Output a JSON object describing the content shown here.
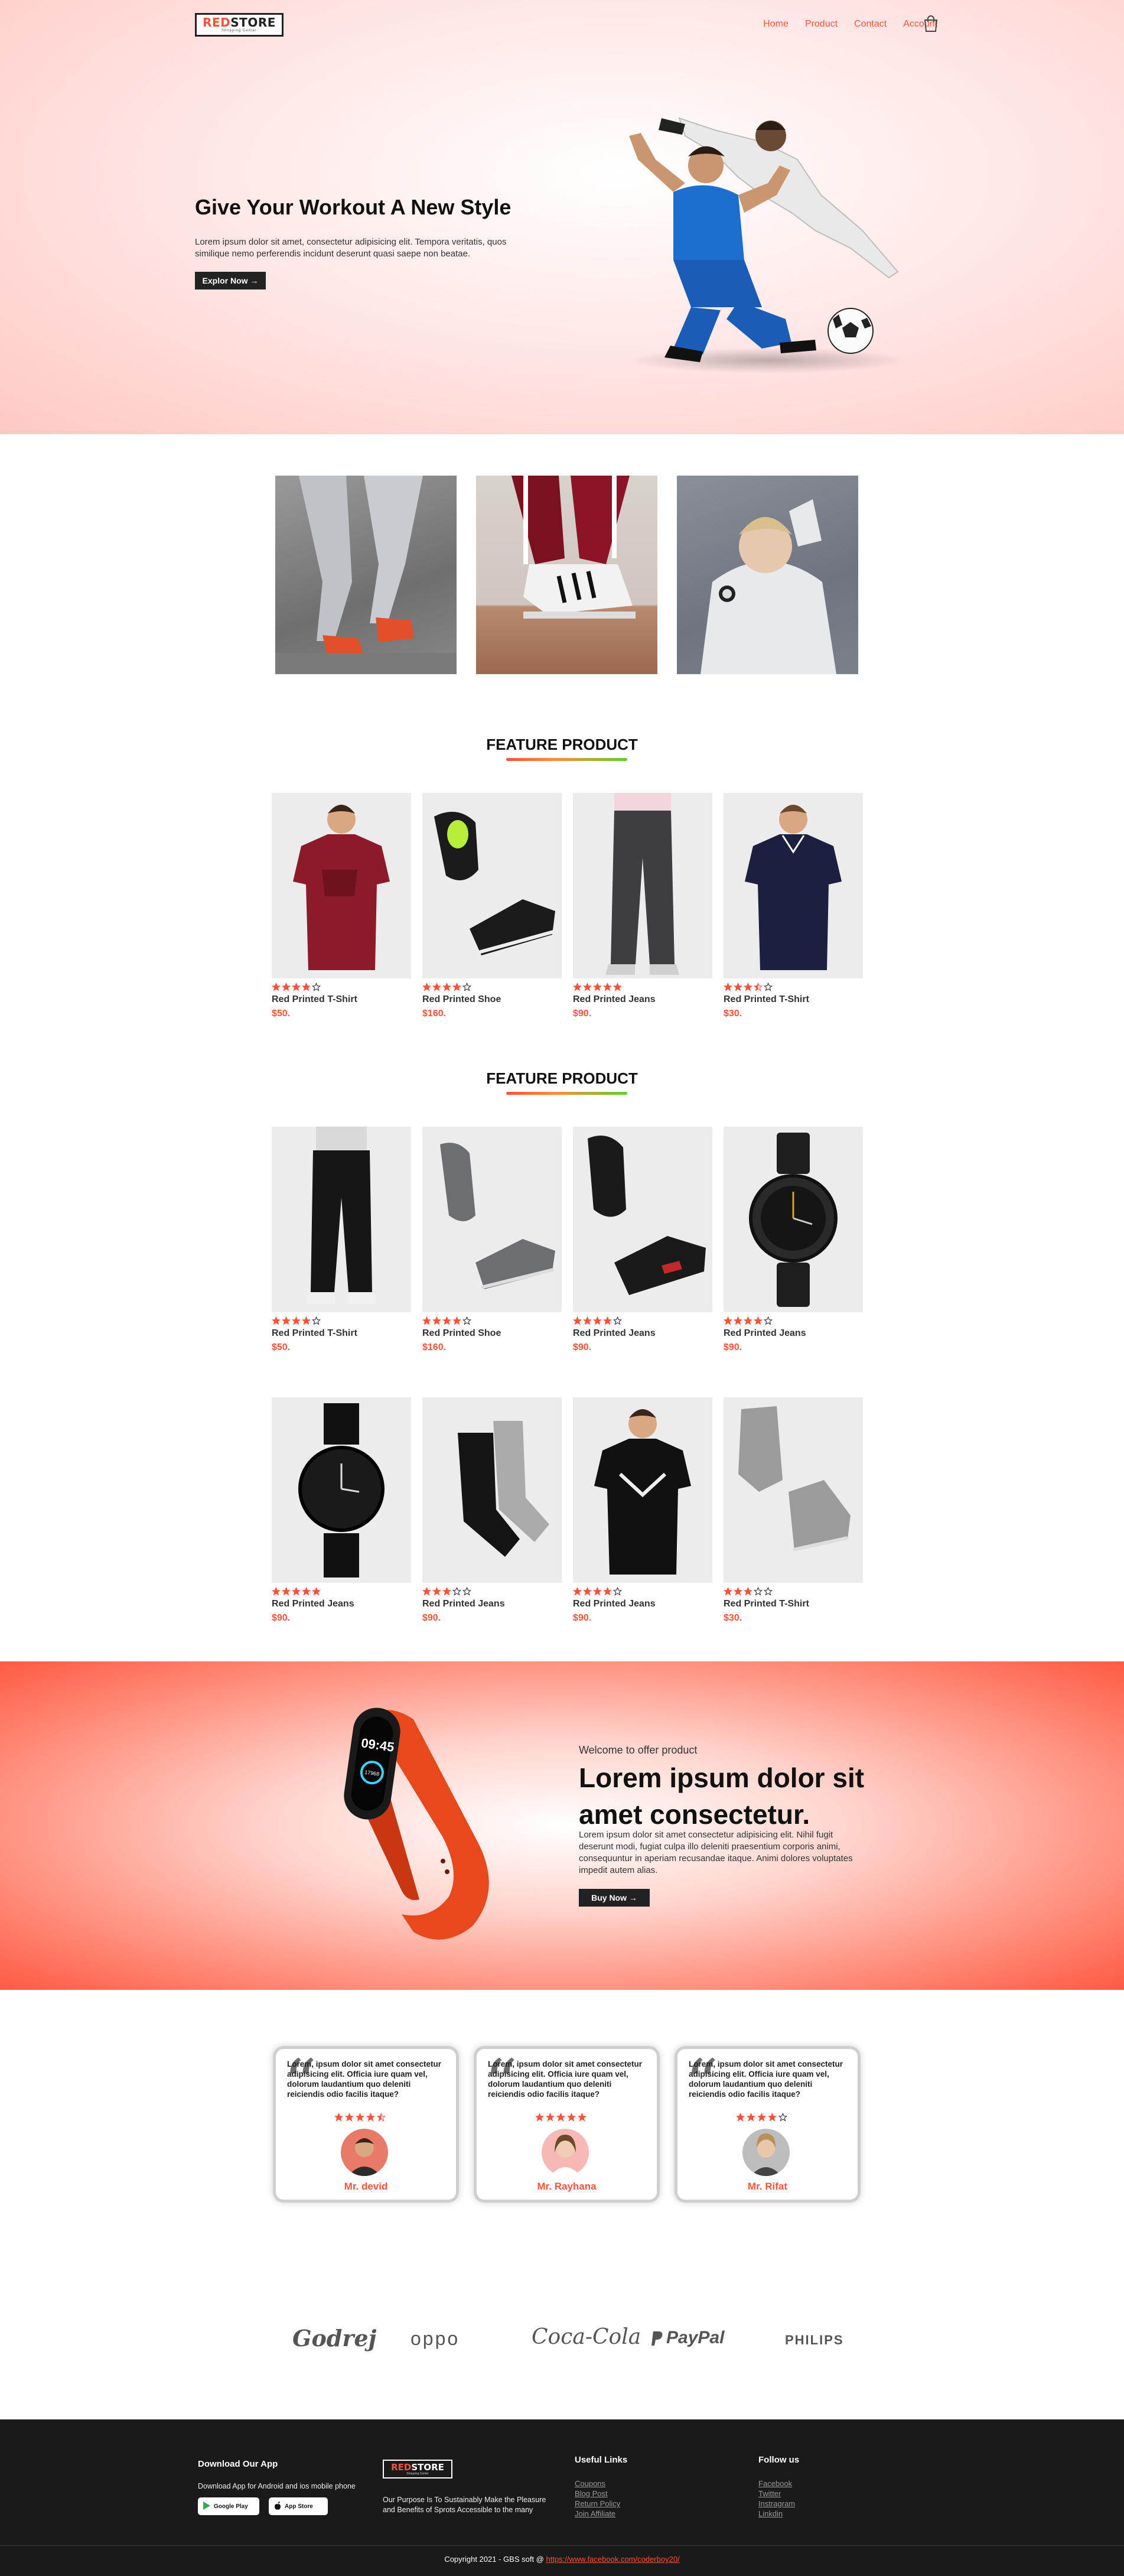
{
  "colors": {
    "accent": "#ff523b",
    "dark": "#222222",
    "footer_bg": "#1a1a1a",
    "star": "#ff523b"
  },
  "header": {
    "logo_red": "RED",
    "logo_dark": "STORE",
    "logo_sub": "Shopping Center",
    "nav": [
      "Home",
      "Product",
      "Contact",
      "Account"
    ],
    "cart_icon": "shopping-bag-icon"
  },
  "hero": {
    "title": "Give Your Workout A New Style",
    "description": "Lorem ipsum dolor sit amet, consectetur adipisicing elit. Tempora veritatis, quos similique nemo perferendis incidunt deserunt quasi saepe non beatae.",
    "button": "Explor Now →"
  },
  "featured_title": "FEATURE PRODUCT",
  "latest_title": "FEATURE PRODUCT",
  "featured_products": [
    {
      "name": "Red Printed T-Shirt",
      "price": "$50.",
      "rating": 4
    },
    {
      "name": "Red Printed Shoe",
      "price": "$160.",
      "rating": 4
    },
    {
      "name": "Red Printed Jeans",
      "price": "$90.",
      "rating": 5
    },
    {
      "name": "Red Printed T-Shirt",
      "price": "$30.",
      "rating": 3.5
    }
  ],
  "latest_products": [
    {
      "name": "Red Printed T-Shirt",
      "price": "$50.",
      "rating": 4
    },
    {
      "name": "Red Printed Shoe",
      "price": "$160.",
      "rating": 4
    },
    {
      "name": "Red Printed Jeans",
      "price": "$90.",
      "rating": 4
    },
    {
      "name": "Red Printed Jeans",
      "price": "$90.",
      "rating": 4
    },
    {
      "name": "Red Printed Jeans",
      "price": "$90.",
      "rating": 5
    },
    {
      "name": "Red Printed Jeans",
      "price": "$90.",
      "rating": 3
    },
    {
      "name": "Red Printed Jeans",
      "price": "$90.",
      "rating": 4
    },
    {
      "name": "Red Printed T-Shirt",
      "price": "$30.",
      "rating": 3
    }
  ],
  "offer": {
    "kicker": "Welcome to offer product",
    "title": "Lorem ipsum dolor sit amet consectetur.",
    "description": "Lorem ipsum dolor sit amet consectetur adipisicing elit. Nihil fugit deserunt modi, fugiat culpa illo deleniti praesentium corporis animi, consequuntur in aperiam recusandae itaque. Animi dolores voluptates impedit autem alias.",
    "button": "Buy Now →",
    "watch_time": "09:45",
    "watch_steps": "17968"
  },
  "testimonials": [
    {
      "text": "Lorem, ipsum dolor sit amet consectetur adipisicing elit. Officia iure quam vel, dolorum laudantium quo deleniti reiciendis odio facilis itaque?",
      "rating": 4.5,
      "name": "Mr. devid"
    },
    {
      "text": "Lorem, ipsum dolor sit amet consectetur adipisicing elit. Officia iure quam vel, dolorum laudantium quo deleniti reiciendis odio facilis itaque?",
      "rating": 5,
      "name": "Mr. Rayhana"
    },
    {
      "text": "Lorem, ipsum dolor sit amet consectetur adipisicing elit. Officia iure quam vel, dolorum laudantium quo deleniti reiciendis odio facilis itaque?",
      "rating": 4,
      "name": "Mr. Rifat"
    }
  ],
  "brands": [
    "Godrej",
    "oppo",
    "Coca-Cola",
    "PayPal",
    "PHILIPS"
  ],
  "footer": {
    "app_title": "Download Our App",
    "app_text": "Download App for Android and ios mobile phone",
    "google_play": "Google Play",
    "app_store": "App Store",
    "logo_red": "RED",
    "logo_light": "STORE",
    "logo_sub": "Shopping Center",
    "purpose": "Our Purpose Is To Sustainably Make the Pleasure and Benefits of Sprots Accessible to the many",
    "useful_title": "Useful Links",
    "useful_links": [
      "Coupons",
      "Blog Post",
      "Return Policy",
      "Join Affiliate"
    ],
    "follow_title": "Follow us",
    "follow_links": [
      "Facebook",
      "Twitter",
      "Instragram",
      "Linkdin"
    ],
    "copyright_prefix": "Copyright 2021 - GBS soft @ ",
    "copyright_link": "https://www.facebook.com/coderboy20/"
  }
}
